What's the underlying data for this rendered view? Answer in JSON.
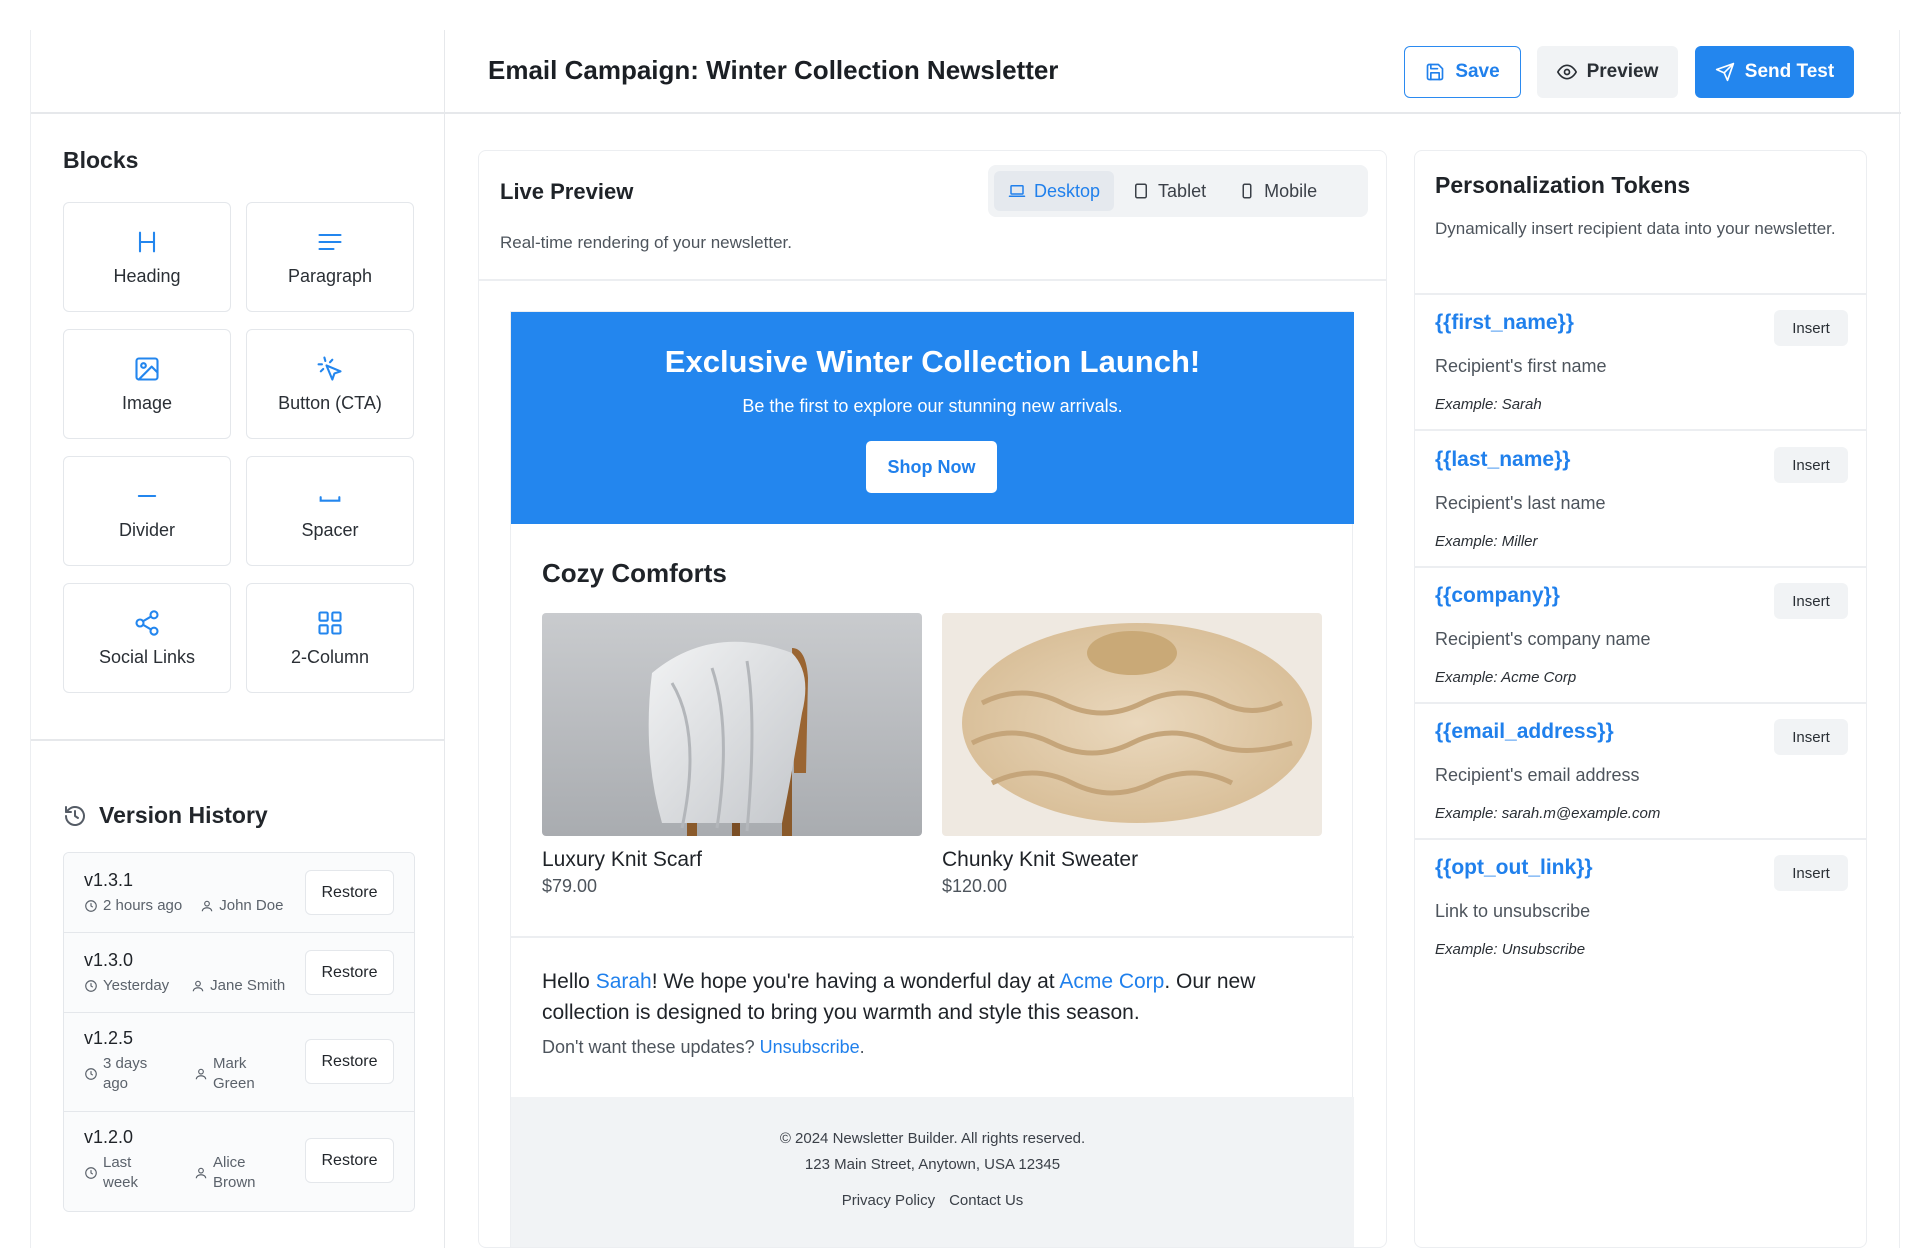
{
  "header": {
    "title": "Email Campaign: Winter Collection Newsletter",
    "save_label": "Save",
    "preview_label": "Preview",
    "send_label": "Send Test"
  },
  "sidebar": {
    "blocks_title": "Blocks",
    "blocks": [
      {
        "label": "Heading",
        "icon": "heading-icon"
      },
      {
        "label": "Paragraph",
        "icon": "paragraph-icon"
      },
      {
        "label": "Image",
        "icon": "image-icon"
      },
      {
        "label": "Button (CTA)",
        "icon": "pointer-click-icon"
      },
      {
        "label": "Divider",
        "icon": "divider-icon"
      },
      {
        "label": "Spacer",
        "icon": "spacer-icon"
      },
      {
        "label": "Social Links",
        "icon": "share-icon"
      },
      {
        "label": "2-Column",
        "icon": "grid-icon"
      }
    ],
    "version_history_title": "Version History",
    "versions": [
      {
        "version": "v1.3.1",
        "time": "2 hours ago",
        "author": "John Doe",
        "restore": "Restore"
      },
      {
        "version": "v1.3.0",
        "time": "Yesterday",
        "author": "Jane Smith",
        "restore": "Restore"
      },
      {
        "version": "v1.2.5",
        "time": "3 days ago",
        "author": "Mark Green",
        "restore": "Restore"
      },
      {
        "version": "v1.2.0",
        "time": "Last week",
        "author": "Alice Brown",
        "restore": "Restore"
      }
    ]
  },
  "preview": {
    "title": "Live Preview",
    "subtitle": "Real-time rendering of your newsletter.",
    "devices": [
      {
        "label": "Desktop",
        "active": true
      },
      {
        "label": "Tablet",
        "active": false
      },
      {
        "label": "Mobile",
        "active": false
      }
    ]
  },
  "email": {
    "hero_title": "Exclusive Winter Collection Launch!",
    "hero_subtitle": "Be the first to explore our stunning new arrivals.",
    "hero_button": "Shop Now",
    "section_title": "Cozy Comforts",
    "products": [
      {
        "name": "Luxury Knit Scarf",
        "price": "$79.00"
      },
      {
        "name": "Chunky Knit Sweater",
        "price": "$120.00"
      }
    ],
    "body": {
      "hello": "Hello ",
      "first_name": "Sarah",
      "mid": "! We hope you're having a wonderful day at ",
      "company": "Acme Corp",
      "end": ". Our new collection is designed to bring you warmth and style this season."
    },
    "unsubscribe_prefix": "Don't want these updates? ",
    "unsubscribe_link": "Unsubscribe",
    "unsubscribe_suffix": ".",
    "footer": {
      "copyright": "© 2024 Newsletter Builder. All rights reserved.",
      "address": "123 Main Street, Anytown, USA 12345",
      "links": [
        "Privacy Policy",
        "Contact Us"
      ]
    }
  },
  "tokens_panel": {
    "title": "Personalization Tokens",
    "subtitle": "Dynamically insert recipient data into your newsletter.",
    "insert_label": "Insert",
    "tokens": [
      {
        "token": "{{first_name}}",
        "desc": "Recipient's first name",
        "example": "Example: Sarah"
      },
      {
        "token": "{{last_name}}",
        "desc": "Recipient's last name",
        "example": "Example: Miller"
      },
      {
        "token": "{{company}}",
        "desc": "Recipient's company name",
        "example": "Example: Acme Corp"
      },
      {
        "token": "{{email_address}}",
        "desc": "Recipient's email address",
        "example": "Example: sarah.m@example.com"
      },
      {
        "token": "{{opt_out_link}}",
        "desc": "Link to unsubscribe",
        "example": "Example: Unsubscribe"
      }
    ]
  },
  "colors": {
    "accent": "#2386ee",
    "border": "#e6e8eb",
    "muted_bg": "#f1f3f5"
  }
}
